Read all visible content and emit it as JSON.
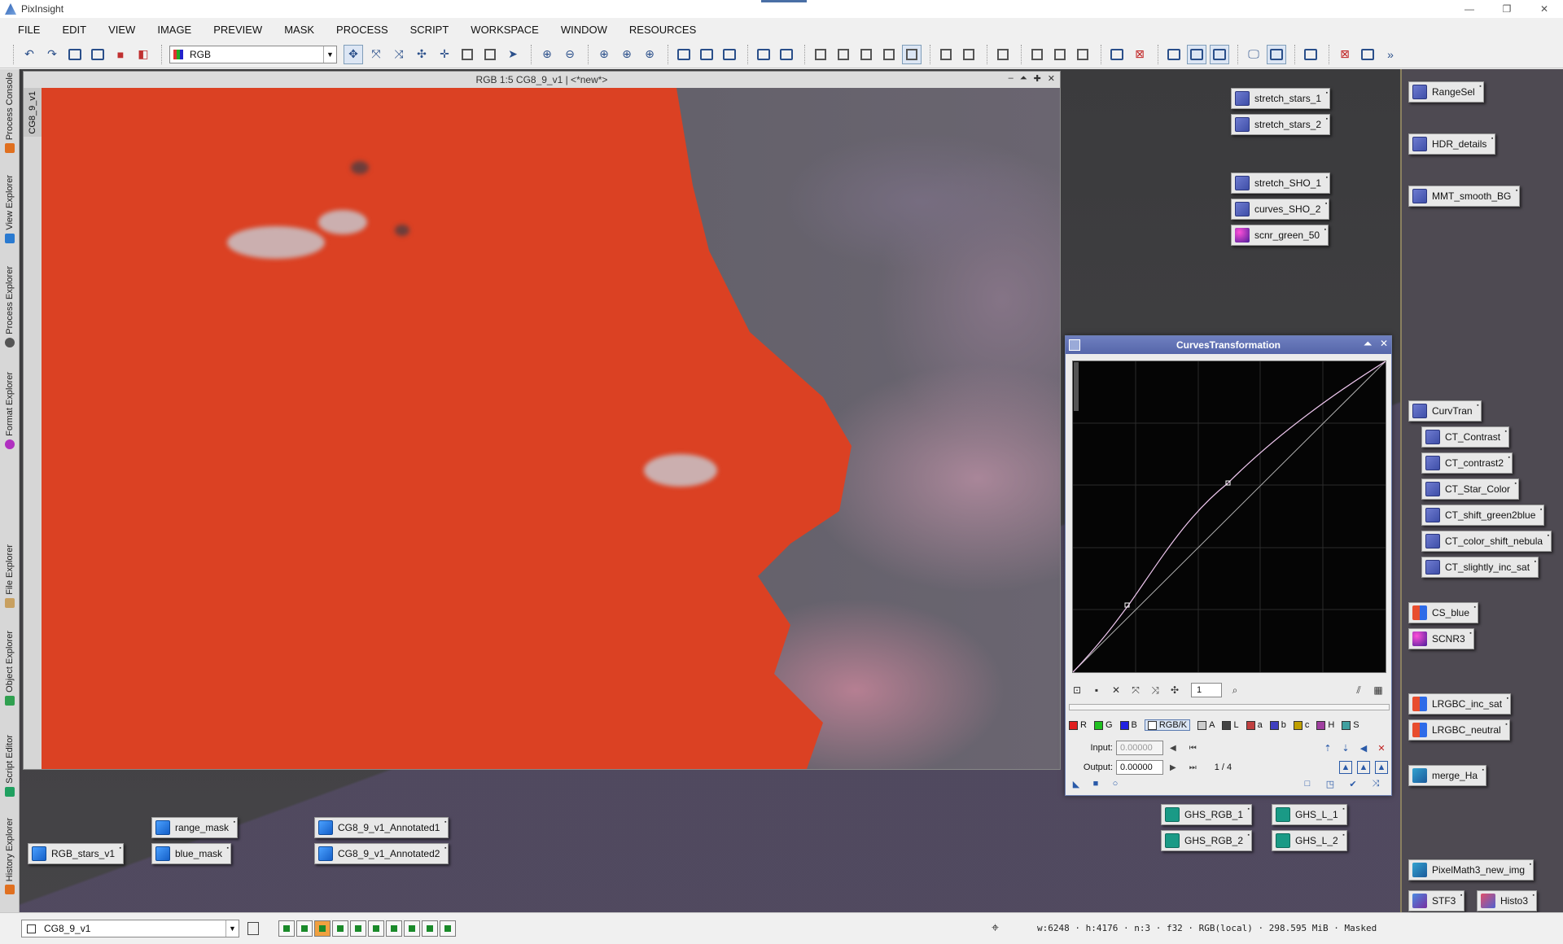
{
  "window": {
    "app_title": "PixInsight",
    "minimize": "—",
    "restore": "❐",
    "close": "✕"
  },
  "menu": [
    "FILE",
    "EDIT",
    "VIEW",
    "IMAGE",
    "PREVIEW",
    "MASK",
    "PROCESS",
    "SCRIPT",
    "WORKSPACE",
    "WINDOW",
    "RESOURCES"
  ],
  "toolbar": {
    "view_select": "RGB"
  },
  "left_tabs": [
    "Process Console",
    "View Explorer",
    "Process Explorer",
    "Format Explorer",
    "File Explorer",
    "Object Explorer",
    "Script Editor",
    "History Explorer"
  ],
  "image_window": {
    "title": "RGB 1:5 CG8_9_v1 | <*new*>",
    "side_label": "CG8_9_v1",
    "btn_min": "‒",
    "btn_shade": "⏶",
    "btn_max": "✚",
    "btn_close": "✕"
  },
  "curves": {
    "title": "CurvesTransformation",
    "zoom_value": "1",
    "channels": [
      {
        "label": "R",
        "color": "#e02020"
      },
      {
        "label": "G",
        "color": "#20c020"
      },
      {
        "label": "B",
        "color": "#2020e0"
      },
      {
        "label": "RGB/K",
        "color": "#ffffff"
      },
      {
        "label": "A",
        "color": "#cccccc"
      },
      {
        "label": "L",
        "color": "#444444"
      },
      {
        "label": "a",
        "color": "#c04040"
      },
      {
        "label": "b",
        "color": "#4040c0"
      },
      {
        "label": "c",
        "color": "#c0a000"
      },
      {
        "label": "H",
        "color": "#a040a0"
      },
      {
        "label": "S",
        "color": "#40a0a0"
      }
    ],
    "input_label": "Input:",
    "input_value": "0.00000",
    "output_label": "Output:",
    "output_value": "0.00000",
    "point_counter": "1 / 4"
  },
  "icons_workspace": {
    "stretch_stars_1": "stretch_stars_1",
    "stretch_stars_2": "stretch_stars_2",
    "stretch_SHO_1": "stretch_SHO_1",
    "curves_SHO_2": "curves_SHO_2",
    "scnr_green_50": "scnr_green_50",
    "GHS_RGB_1": "GHS_RGB_1",
    "GHS_RGB_2": "GHS_RGB_2",
    "GHS_L_1": "GHS_L_1",
    "GHS_L_2": "GHS_L_2",
    "RGB_stars_v1": "RGB_stars_v1",
    "range_mask": "range_mask",
    "blue_mask": "blue_mask",
    "CG8_9_v1_Annotated1": "CG8_9_v1_Annotated1",
    "CG8_9_v1_Annotated2": "CG8_9_v1_Annotated2"
  },
  "icons_right": {
    "RangeSel": "RangeSel",
    "HDR_details": "HDR_details",
    "MMT_smooth_BG": "MMT_smooth_BG",
    "CurvTran": "CurvTran",
    "CT_Contrast": "CT_Contrast",
    "CT_contrast2": "CT_contrast2",
    "CT_Star_Color": "CT_Star_Color",
    "CT_shift_green2blue": "CT_shift_green2blue",
    "CT_color_shift_nebula": "CT_color_shift_nebula",
    "CT_slightly_inc_sat": "CT_slightly_inc_sat",
    "CS_blue": "CS_blue",
    "SCNR3": "SCNR3",
    "LRGBC_inc_sat": "LRGBC_inc_sat",
    "LRGBC_neutral": "LRGBC_neutral",
    "merge_Ha": "merge_Ha",
    "PixelMath3_new_img": "PixelMath3_new_img",
    "STF3": "STF3",
    "Histo3": "Histo3"
  },
  "statusbar": {
    "view_select": "CG8_9_v1",
    "info": "w:6248 · h:4176 · n:3 · f32 · RGB(local) · 298.595 MiB · Masked"
  }
}
